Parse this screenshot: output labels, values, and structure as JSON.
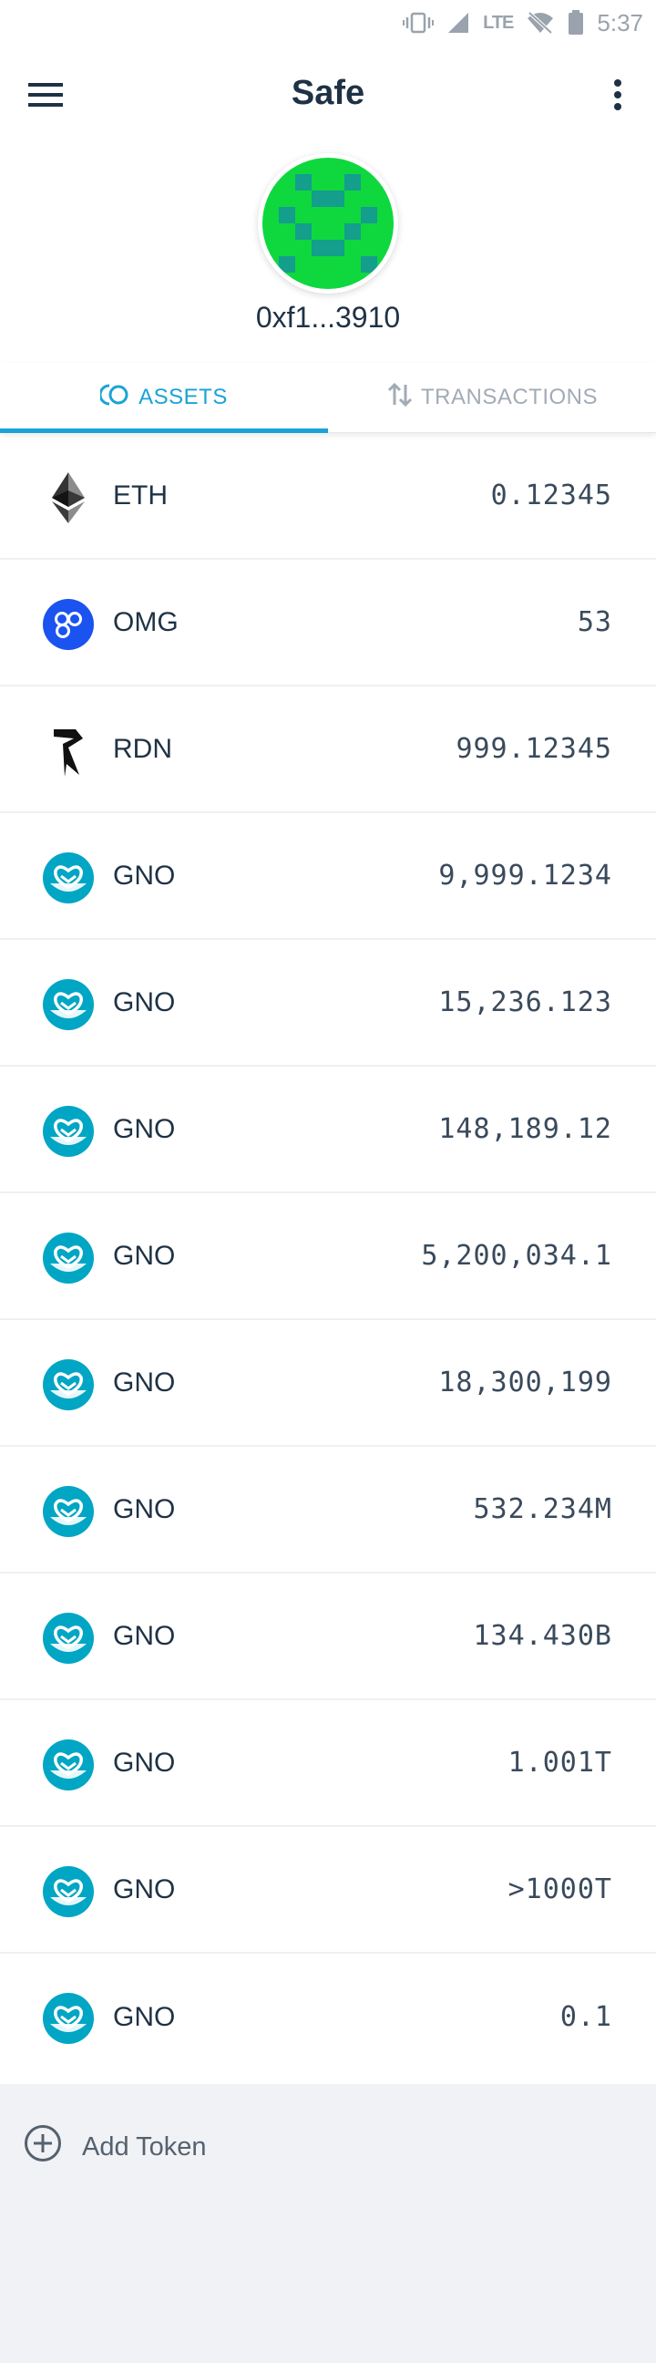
{
  "status_bar": {
    "network": "LTE",
    "time": "5:37",
    "icons": [
      "vibrate-icon",
      "signal-icon",
      "wifi-off-icon",
      "battery-icon"
    ]
  },
  "app_bar": {
    "title": "Safe",
    "menu_icon": "hamburger-menu-icon",
    "more_icon": "more-vertical-icon"
  },
  "safe": {
    "address_short": "0xf1...3910",
    "identicon_colors": [
      "#0ed83e",
      "#149e8c"
    ]
  },
  "tabs": [
    {
      "label": "ASSETS",
      "icon": "assets-icon",
      "active": true
    },
    {
      "label": "TRANSACTIONS",
      "icon": "transfer-arrows-icon",
      "active": false
    }
  ],
  "tokens": [
    {
      "symbol": "ETH",
      "balance": "0.12345",
      "icon": "eth-icon"
    },
    {
      "symbol": "OMG",
      "balance": "53",
      "icon": "omg-icon"
    },
    {
      "symbol": "RDN",
      "balance": "999.12345",
      "icon": "rdn-icon"
    },
    {
      "symbol": "GNO",
      "balance": "9,999.1234",
      "icon": "gno-icon"
    },
    {
      "symbol": "GNO",
      "balance": "15,236.123",
      "icon": "gno-icon"
    },
    {
      "symbol": "GNO",
      "balance": "148,189.12",
      "icon": "gno-icon"
    },
    {
      "symbol": "GNO",
      "balance": "5,200,034.1",
      "icon": "gno-icon"
    },
    {
      "symbol": "GNO",
      "balance": "18,300,199",
      "icon": "gno-icon"
    },
    {
      "symbol": "GNO",
      "balance": "532.234M",
      "icon": "gno-icon"
    },
    {
      "symbol": "GNO",
      "balance": "134.430B",
      "icon": "gno-icon"
    },
    {
      "symbol": "GNO",
      "balance": "1.001T",
      "icon": "gno-icon"
    },
    {
      "symbol": "GNO",
      "balance": ">1000T",
      "icon": "gno-icon"
    },
    {
      "symbol": "GNO",
      "balance": "0.1",
      "icon": "gno-icon"
    }
  ],
  "footer": {
    "add_token_label": "Add Token",
    "add_icon": "add-circle-icon"
  },
  "colors": {
    "accent": "#1aa3d6",
    "text_primary": "#1f3245",
    "footer_bg": "#f1f2f6",
    "omg_blue": "#1a53f0",
    "gno_teal": "#00a6c4"
  }
}
